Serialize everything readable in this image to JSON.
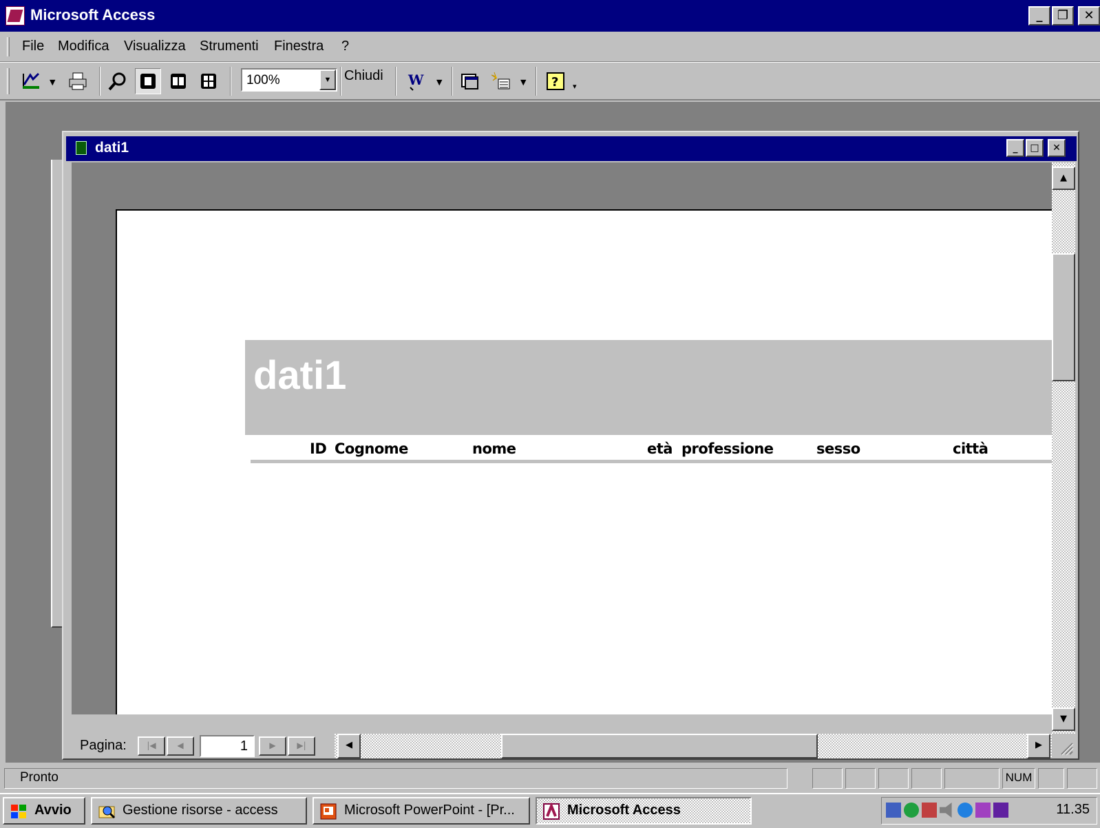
{
  "window": {
    "title": "Microsoft Access",
    "controls": {
      "minimize": "_",
      "restore": "❐",
      "close": "✕"
    }
  },
  "menu": {
    "items": [
      "File",
      "Modifica",
      "Visualizza",
      "Strumenti",
      "Finestra",
      "?"
    ]
  },
  "toolbar": {
    "icons": [
      "design-view-icon",
      "print-icon",
      "zoom-icon",
      "one-page-icon",
      "two-pages-icon",
      "multiple-pages-icon",
      "word-icon",
      "database-window-icon",
      "new-object-icon",
      "help-icon"
    ],
    "zoom_value": "100%",
    "close_label": "Chiudi"
  },
  "child_window": {
    "title": "dati1",
    "controls": {
      "minimize": "_",
      "maximize": "□",
      "close": "✕"
    }
  },
  "report": {
    "title": "dati1",
    "columns": [
      "ID",
      "Cognome",
      "nome",
      "età",
      "professione",
      "sesso",
      "città"
    ]
  },
  "navigation": {
    "page_label": "Pagina:",
    "page_number": "1"
  },
  "status_bar": {
    "text": "Pronto",
    "indicators": [
      "",
      "",
      "",
      "",
      "",
      "NUM",
      "",
      ""
    ]
  },
  "taskbar": {
    "start_label": "Avvio",
    "tasks": [
      {
        "label": "Gestione risorse - access",
        "active": false
      },
      {
        "label": "Microsoft PowerPoint - [Pr...",
        "active": false
      },
      {
        "label": "Microsoft Access",
        "active": true
      }
    ],
    "clock": "11.35"
  },
  "colors": {
    "title_bar": "#000080",
    "face": "#c0c0c0",
    "workspace": "#808080",
    "report_header": "#c0c0c0"
  }
}
